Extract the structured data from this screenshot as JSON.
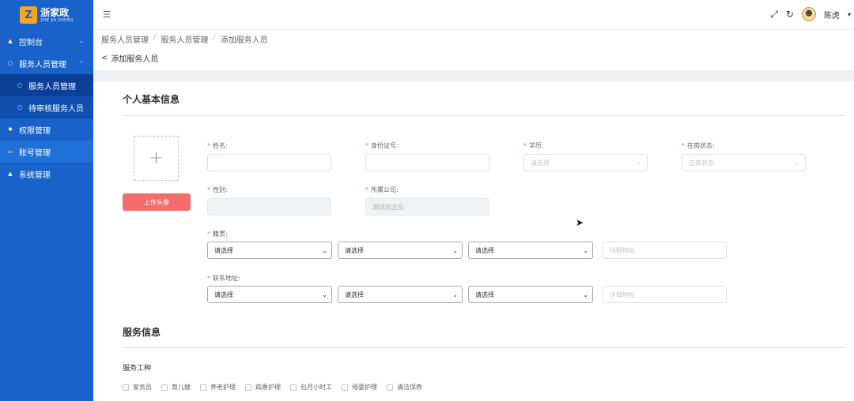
{
  "logo": {
    "title": "浙家政",
    "subtitle": "ZHE JIA ZHENG",
    "mark": "Z"
  },
  "sidebar": {
    "items": [
      {
        "label": "控制台",
        "icon": "person-icon",
        "has_chevron": true
      },
      {
        "label": "服务人员管理",
        "icon": "circle-icon",
        "has_chevron": true
      },
      {
        "label": "服务人员管理",
        "icon": "circle-icon",
        "sub": true
      },
      {
        "label": "待审核服务人员",
        "icon": "circle-icon",
        "sub": true
      },
      {
        "label": "权限管理",
        "icon": "gear-icon"
      },
      {
        "label": "账号管理",
        "icon": "card-icon"
      },
      {
        "label": "系统管理",
        "icon": "person-icon"
      }
    ]
  },
  "header": {
    "username": "陈虎"
  },
  "breadcrumb": [
    "服务人员管理",
    "服务人员管理",
    "添加服务人员"
  ],
  "back_label": "添加服务人员",
  "basic": {
    "title": "个人基本信息",
    "upload_label": "上传头像",
    "name_label": "姓名:",
    "id_label": "身份证号:",
    "edu_label": "学历:",
    "edu_placeholder": "请选择",
    "status_label": "在岗状态:",
    "status_placeholder": "在岗状态:",
    "gender_label": "性别:",
    "company_label": "所属公司:",
    "company_value": "测试的企业",
    "native_label": "籍贯:",
    "address_label": "联系地址:",
    "select_placeholder": "请选择",
    "detail_placeholder": "详细地址"
  },
  "service": {
    "title": "服务信息",
    "types_label": "服务工种",
    "types": [
      "家务员",
      "育儿嫂",
      "养老护理",
      "病患护理",
      "包月小时工",
      "母婴护理",
      "清洁保养"
    ]
  }
}
